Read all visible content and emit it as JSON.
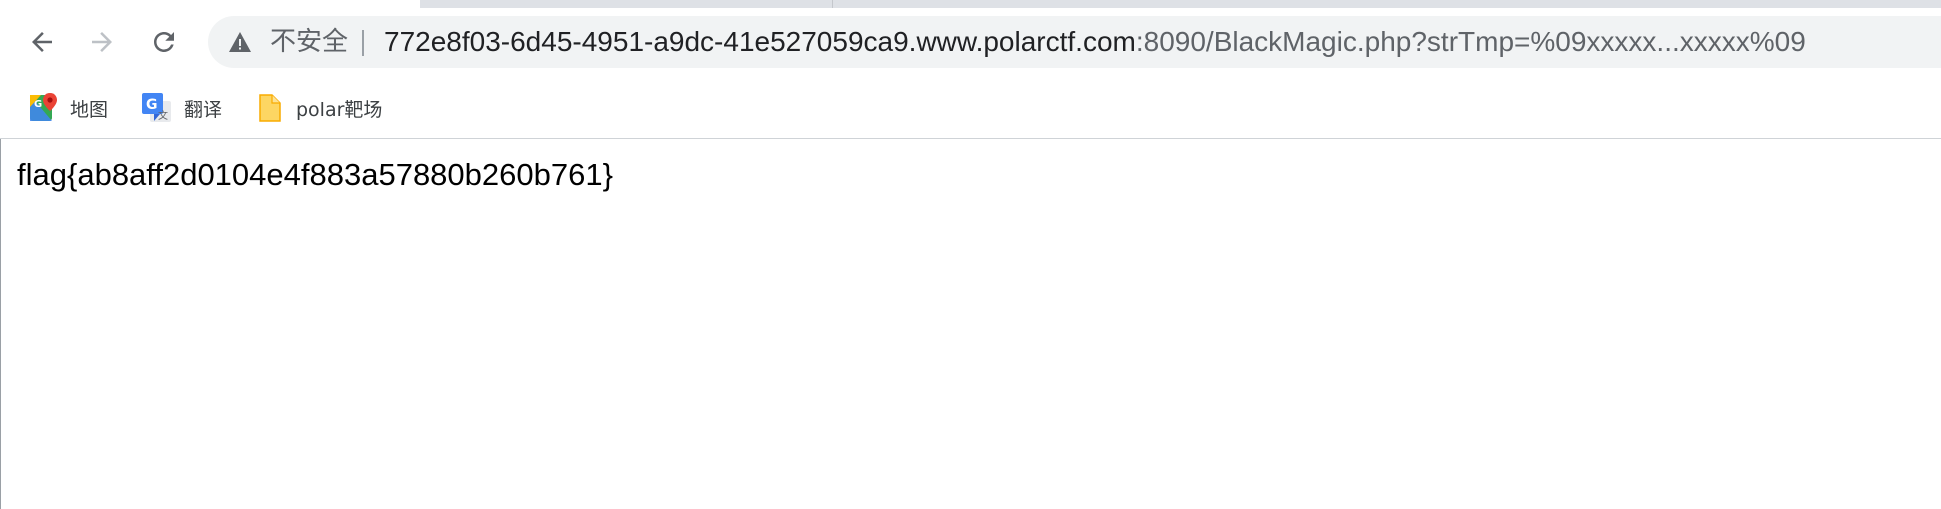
{
  "browser": {
    "toolbar": {
      "back_icon": "arrow-left-icon",
      "forward_icon": "arrow-right-icon",
      "reload_icon": "reload-icon"
    },
    "omnibox": {
      "security_icon": "warning-icon",
      "security_label": "不安全",
      "url_host": "772e8f03-6d45-4951-a9dc-41e527059ca9.www.polarctf.com",
      "url_path": ":8090/BlackMagic.php?strTmp=%09xxxxx...xxxxx%09"
    },
    "bookmarks": [
      {
        "label": "地图",
        "icon": "google-maps-icon"
      },
      {
        "label": "翻译",
        "icon": "google-translate-icon"
      },
      {
        "label": "polar靶场",
        "icon": "folder-icon"
      }
    ]
  },
  "page": {
    "body_text": "flag{ab8aff2d0104e4f883a57880b260b761}"
  },
  "colors": {
    "omnibox_bg": "#f1f3f4",
    "tabstrip_bg": "#dee1e6",
    "url_host": "#202124",
    "url_path": "#5f6368",
    "folder_yellow": "#fdd663"
  }
}
